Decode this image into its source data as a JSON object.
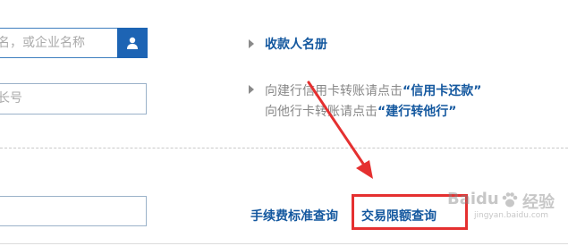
{
  "form": {
    "payee_placeholder": "名，或企业名称",
    "account_placeholder": "长号"
  },
  "payee_book_link": "收款人名册",
  "hint": {
    "line1_prefix": "向建行信用卡转账请点击",
    "line1_link": "“信用卡还款”",
    "line2_prefix": "向他行卡转账请点击",
    "line2_link": "“建行转他行”"
  },
  "bottom_links": {
    "fee_query": "手续费标准查询",
    "limit_query": "交易限额查询"
  },
  "watermark": {
    "brand": "Baidu",
    "chinese": "经验",
    "url": "jingyan.baidu.com"
  },
  "colors": {
    "accent_blue": "#1d64b4",
    "link_blue": "#14589f",
    "annotation_red": "#e53030"
  },
  "icons": {
    "user_button": "user-icon",
    "bullets": "triangle-right-icon",
    "annotation": "red-arrow"
  }
}
